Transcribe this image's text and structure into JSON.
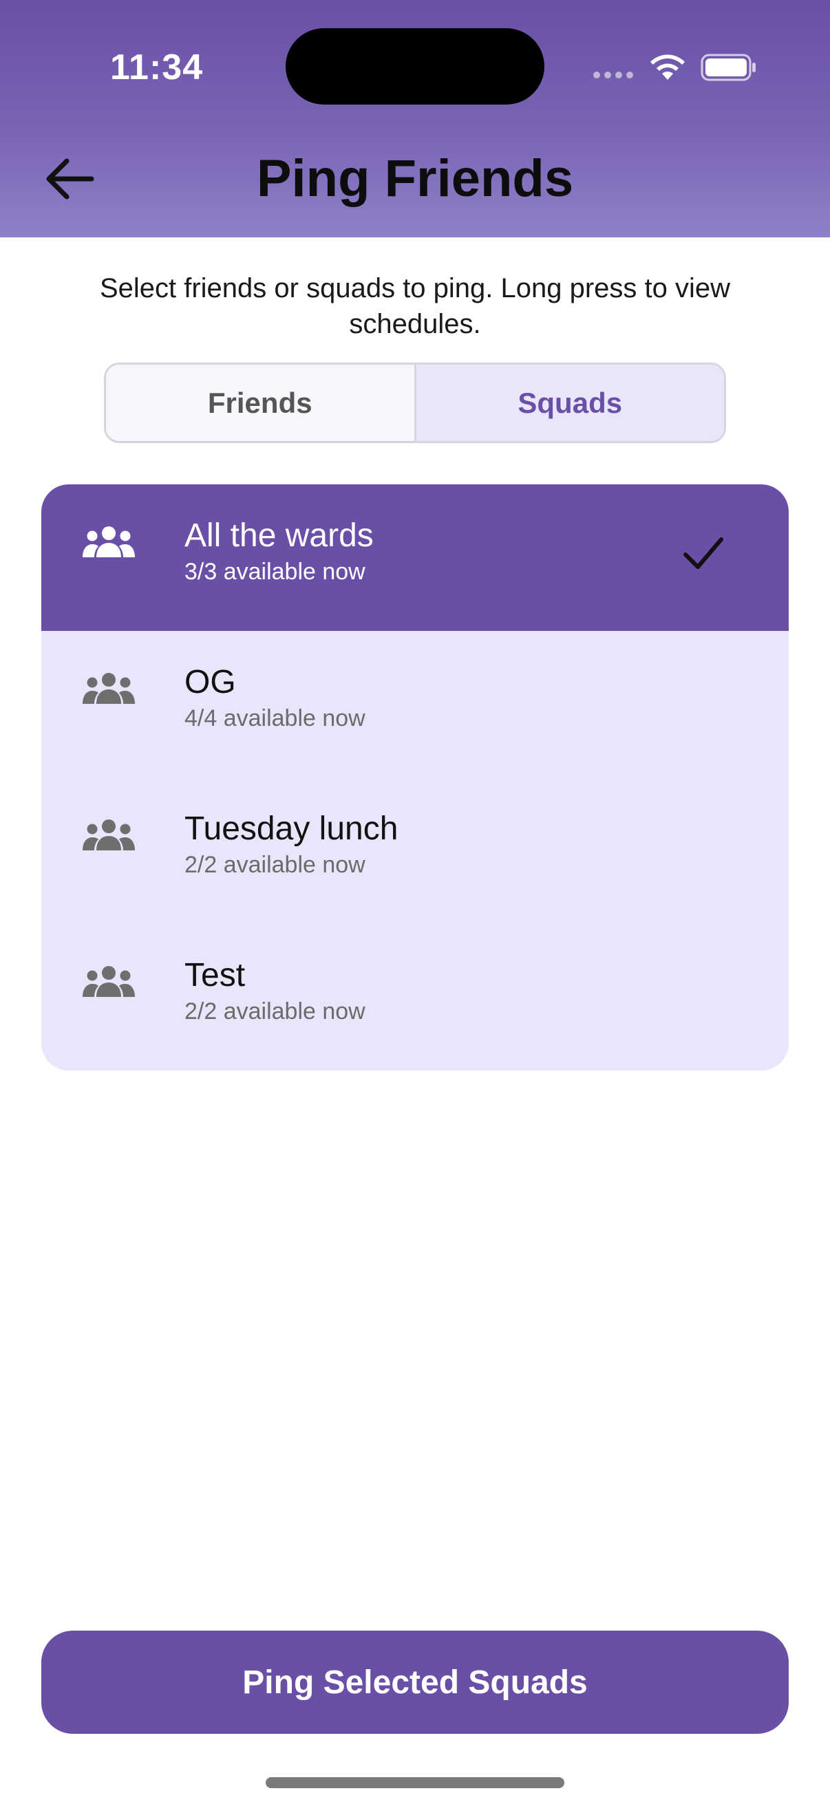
{
  "status_bar": {
    "time": "11:34",
    "signal_icon": "cellular-signal-icon",
    "wifi_icon": "wifi-icon",
    "battery_icon": "battery-icon"
  },
  "header": {
    "title": "Ping Friends",
    "back_icon": "arrow-left-icon"
  },
  "instruction": "Select friends or squads to ping. Long press to view schedules.",
  "tabs": [
    {
      "label": "Friends",
      "active": false
    },
    {
      "label": "Squads",
      "active": true
    }
  ],
  "squads": [
    {
      "name": "All the wards",
      "availability": "3/3 available now",
      "selected": true,
      "icon": "group-icon"
    },
    {
      "name": "OG",
      "availability": "4/4 available now",
      "selected": false,
      "icon": "group-icon"
    },
    {
      "name": "Tuesday lunch",
      "availability": "2/2 available now",
      "selected": false,
      "icon": "group-icon"
    },
    {
      "name": "Test",
      "availability": "2/2 available now",
      "selected": false,
      "icon": "group-icon"
    }
  ],
  "action_button": {
    "label": "Ping Selected Squads"
  },
  "colors": {
    "accent": "#6a4fa6",
    "list_background": "#e9e6fb",
    "header_gradient_start": "#6a4fa6",
    "header_gradient_end": "#8f80c8"
  }
}
